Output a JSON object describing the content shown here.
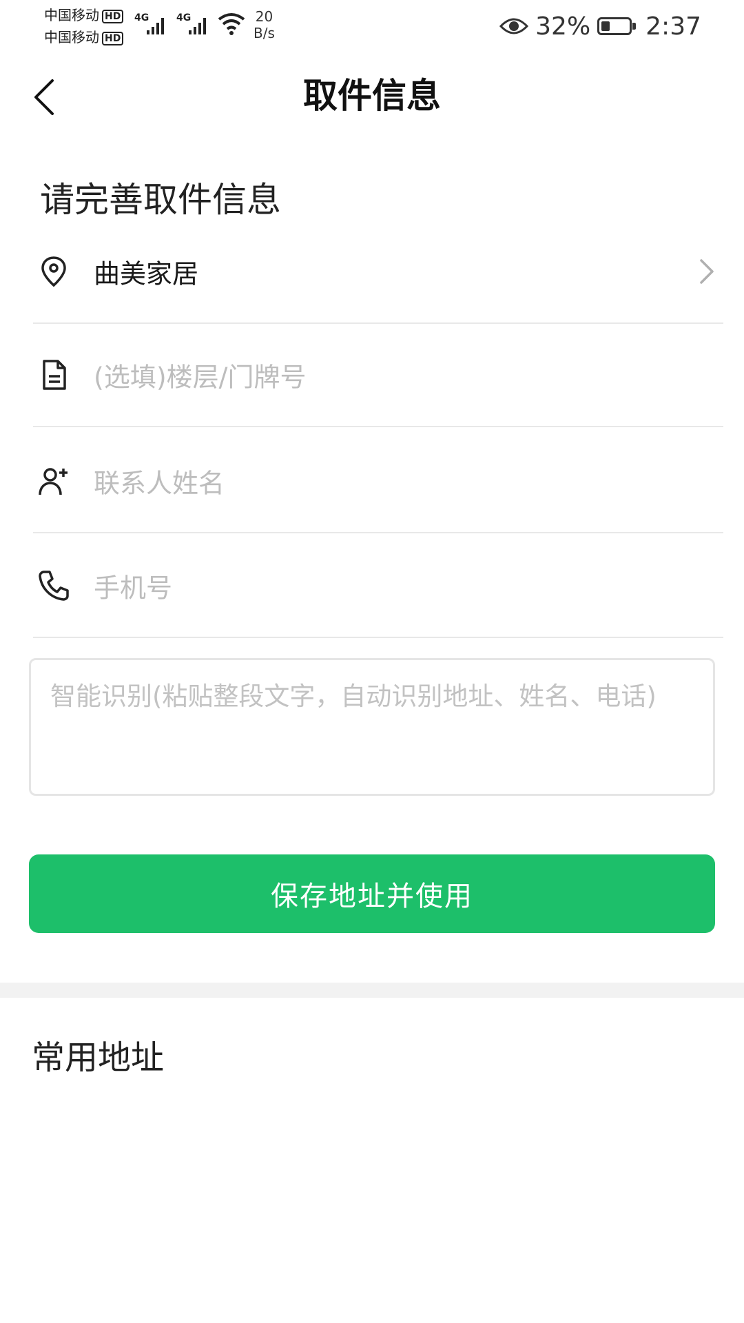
{
  "status_bar": {
    "carrier1": "中国移动",
    "carrier2": "中国移动",
    "hd_label": "HD",
    "network": "4G",
    "net_speed_value": "20",
    "net_speed_unit": "B/s",
    "battery_percent": "32%",
    "battery_level": 0.32,
    "time": "2:37"
  },
  "header": {
    "title": "取件信息"
  },
  "form": {
    "section_title": "请完善取件信息",
    "address": "曲美家居",
    "floor_placeholder": "(选填)楼层/门牌号",
    "name_placeholder": "联系人姓名",
    "phone_placeholder": "手机号",
    "smart_placeholder": "智能识别(粘贴整段文字，自动识别地址、姓名、电话)"
  },
  "save_button": "保存地址并使用",
  "common_title": "常用地址",
  "colors": {
    "accent": "#1dbf6a"
  }
}
